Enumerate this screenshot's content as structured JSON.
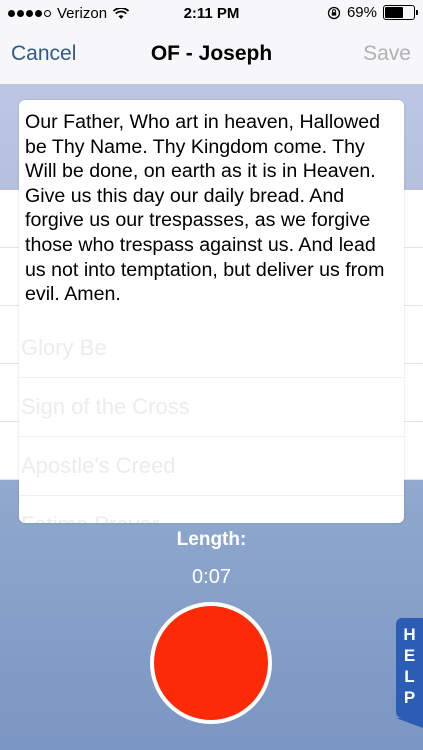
{
  "status_bar": {
    "carrier": "Verizon",
    "time": "2:11 PM",
    "battery_percent": "69%",
    "battery_level": 0.69,
    "icons": [
      "signal-dots-icon",
      "wifi-icon",
      "rotation-lock-icon",
      "battery-icon"
    ]
  },
  "nav": {
    "cancel_label": "Cancel",
    "title": "OF - Joseph",
    "save_label": "Save"
  },
  "prayer": {
    "text": "Our Father, Who art in heaven, Hallowed be Thy Name. Thy Kingdom come. Thy Will be done, on earth as it is in Heaven. Give us this day our daily bread. And forgive us our trespasses, as we forgive those who trespass against us. And lead us not into temptation, but deliver us from evil. Amen."
  },
  "background_list": {
    "items": [
      "Glory Be",
      "Sign of the Cross",
      "Apostle's Creed",
      "Fatima Prayer"
    ]
  },
  "recording": {
    "length_label": "Length:",
    "length_value": "0:07"
  },
  "help": {
    "letters": [
      "H",
      "E",
      "L",
      "P"
    ]
  },
  "colors": {
    "nav_link": "#2f5a8d",
    "record": "#fd2a07",
    "help_tab": "#2a5db3"
  }
}
